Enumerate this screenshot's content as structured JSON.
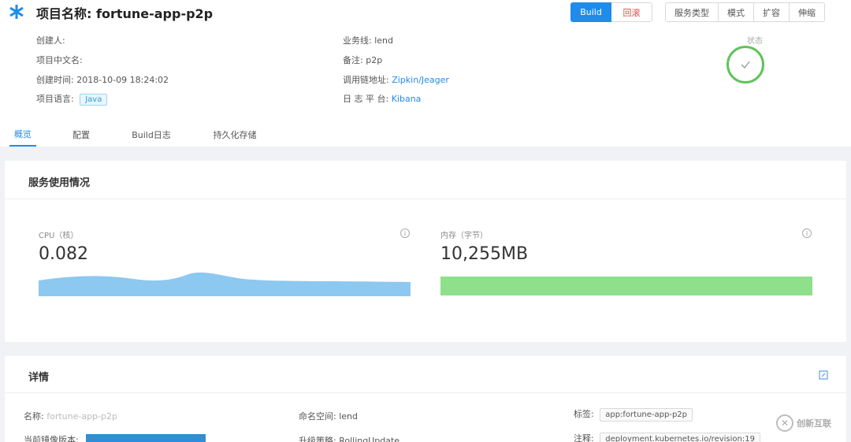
{
  "project": {
    "title_label": "项目名称:",
    "title_value": "fortune-app-p2p"
  },
  "buttons": {
    "build": "Build",
    "rollback": "回滚",
    "service_type": "服务类型",
    "mode": "模式",
    "scale_out": "扩容",
    "scale": "伸缩"
  },
  "meta_left": {
    "creator_label": "创建人:",
    "chinese_name_label": "项目中文名:",
    "created_time_label": "创建时间:",
    "created_time_value": "2018-10-09 18:24:02",
    "language_label": "项目语言:",
    "language_value": "Java"
  },
  "meta_right": {
    "business_label": "业务线:",
    "business_value": "lend",
    "remark_label": "备注:",
    "remark_value": "p2p",
    "trace_label": "调用链地址:",
    "trace_value": "Zipkin/Jeager",
    "log_label": "日 志 平 台:",
    "log_value": "Kibana"
  },
  "status": {
    "label": "状态"
  },
  "tabs": [
    {
      "label": "概览"
    },
    {
      "label": "配置"
    },
    {
      "label": "Build日志"
    },
    {
      "label": "持久化存储"
    }
  ],
  "usage": {
    "title": "服务使用情况",
    "cpu_label": "CPU（核）",
    "cpu_value": "0.082",
    "mem_label": "内存（字节）",
    "mem_value": "10,255MB",
    "cpu_color": "#8cc8f0",
    "mem_color": "#8fe08a"
  },
  "details": {
    "title": "详情",
    "name_label": "名称:",
    "name_value": "fortune-app-p2p",
    "namespace_label": "命名空间:",
    "namespace_value": "lend",
    "labels_label": "标签:",
    "labels_value": "app:fortune-app-p2p",
    "image_label": "当前镜像版本:",
    "upgrade_label": "升级策略:",
    "upgrade_value": "RollingUpdate",
    "annotation_label": "注释:",
    "annotation_value": "deployment.kubernetes.io/revision:19"
  },
  "watermark": {
    "text": "创新互联"
  }
}
